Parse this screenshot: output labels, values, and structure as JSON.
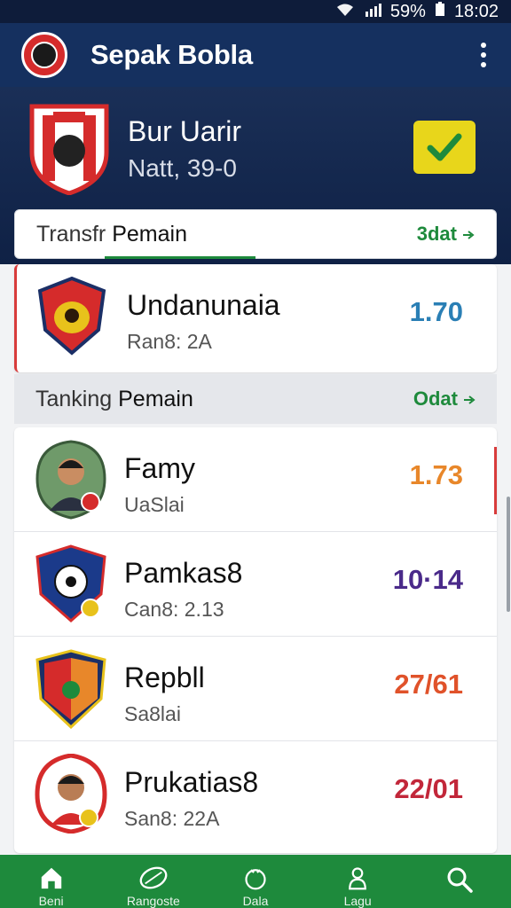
{
  "status_bar": {
    "battery": "59%",
    "time": "18:02"
  },
  "app_bar": {
    "title": "Sepak Bobla"
  },
  "hero": {
    "name": "Bur Uarir",
    "subtitle": "Natt, 39-0"
  },
  "transfer_section": {
    "title_prefix": "Transfr ",
    "title_main": "Pemain",
    "action": "3dat",
    "item": {
      "name": "Undanunaia",
      "sub": "Ran8: 2A",
      "value": "1.70",
      "color": "#2a7fb5"
    }
  },
  "ranking_section": {
    "title_prefix": "Tanking ",
    "title_main": "Pemain",
    "action": "Odat",
    "items": [
      {
        "name": "Famy",
        "sub": "UaSlai",
        "value": "1.73",
        "color": "#e8872a"
      },
      {
        "name": "Pamkas8",
        "sub": "Can8: 2.13",
        "value": "10·14",
        "color": "#4a2a8a"
      },
      {
        "name": "Repbll",
        "sub": "Sa8lai",
        "value": "27/61",
        "color": "#e0522a"
      },
      {
        "name": "Prukatias8",
        "sub": "San8: 22A",
        "value": "22/01",
        "color": "#c2273a"
      }
    ]
  },
  "bottom_nav": [
    {
      "icon": "home-icon",
      "label": "Beni"
    },
    {
      "icon": "ball-icon",
      "label": "Rangoste"
    },
    {
      "icon": "team-icon",
      "label": "Dala"
    },
    {
      "icon": "person-icon",
      "label": "Lagu"
    },
    {
      "icon": "search-icon",
      "label": ""
    }
  ]
}
